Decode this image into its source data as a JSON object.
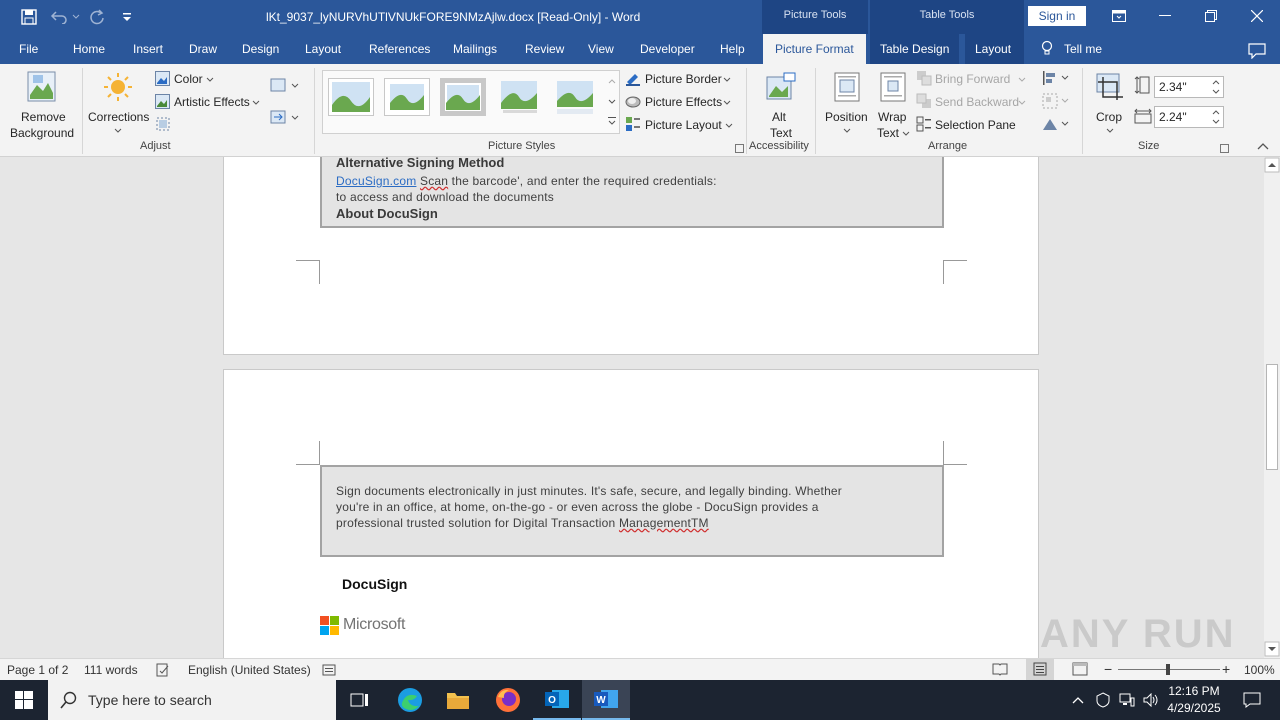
{
  "titlebar": {
    "doc_title": "lKt_9037_lyNURVhUTlVNUkFORE9NMzAjlw.docx [Read-Only]  -  Word",
    "picture_tools": "Picture Tools",
    "table_tools": "Table Tools",
    "sign_in": "Sign in"
  },
  "tabs": [
    "File",
    "Home",
    "Insert",
    "Draw",
    "Design",
    "Layout",
    "References",
    "Mailings",
    "Review",
    "View",
    "Developer",
    "Help",
    "Picture Format",
    "Table Design",
    "Layout"
  ],
  "tell_me": "Tell me",
  "ribbon": {
    "remove_background_1": "Remove",
    "remove_background_2": "Background",
    "corrections": "Corrections",
    "color": "Color",
    "artistic_effects": "Artistic Effects",
    "adjust_label": "Adjust",
    "picture_styles_label": "Picture Styles",
    "picture_border": "Picture Border",
    "picture_effects": "Picture Effects",
    "picture_layout": "Picture Layout",
    "alt_text_1": "Alt",
    "alt_text_2": "Text",
    "accessibility_label": "Accessibility",
    "position": "Position",
    "wrap_text_1": "Wrap",
    "wrap_text_2": "Text",
    "bring_forward": "Bring Forward",
    "send_backward": "Send Backward",
    "selection_pane": "Selection Pane",
    "arrange_label": "Arrange",
    "crop": "Crop",
    "height_value": "2.34\"",
    "width_value": "2.24\"",
    "size_label": "Size"
  },
  "document": {
    "page1": {
      "heading_alt": "Alternative Signing Method",
      "link_text": "DocuSign.com",
      "line1_scan": "Scan",
      "line1_rest": " the barcode', and enter the required  credentials:",
      "line2": "to access and download the documents",
      "heading_about": "About DocuSign"
    },
    "page2": {
      "para1": "Sign documents electronically in just minutes. It's safe, secure, and legally binding. Whether",
      "para2": "you're in an office, at home, on-the-go - or even across the globe - DocuSign provides a",
      "para3_a": "professional trusted solution for Digital Transaction ",
      "para3_b": "ManagementTM",
      "docusign_logo": "DocuSign",
      "microsoft_logo": "Microsoft"
    }
  },
  "statusbar": {
    "page": "Page 1 of 2",
    "words": "111 words",
    "language": "English (United States)",
    "zoom": "100%"
  },
  "taskbar": {
    "search_placeholder": "Type here to search",
    "time": "12:16 PM",
    "date": "4/29/2025"
  },
  "watermark": "ANY RUN",
  "colors": {
    "accent": "#2b579a",
    "context_tab": "#1e4584",
    "taskbar": "#1c2431"
  }
}
